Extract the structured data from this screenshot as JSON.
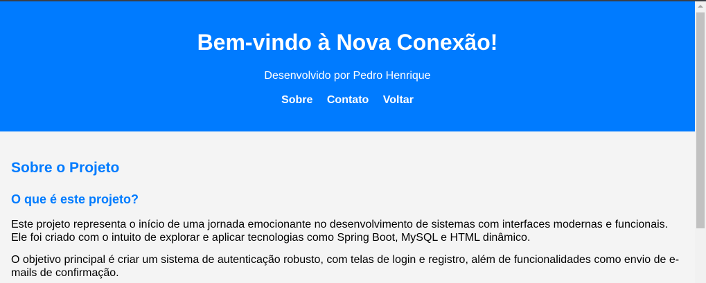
{
  "header": {
    "title": "Bem-vindo à Nova Conexão!",
    "subtitle": "Desenvolvido por Pedro Henrique",
    "nav": [
      {
        "label": "Sobre"
      },
      {
        "label": "Contato"
      },
      {
        "label": "Voltar"
      }
    ]
  },
  "main": {
    "section_title": "Sobre o Projeto",
    "subsection_title": "O que é este projeto?",
    "paragraph_1": "Este projeto representa o início de uma jornada emocionante no desenvolvimento de sistemas com interfaces modernas e funcionais. Ele foi criado com o intuito de explorar e aplicar tecnologias como Spring Boot, MySQL e HTML dinâmico.",
    "paragraph_2": "O objetivo principal é criar um sistema de autenticação robusto, com telas de login e registro, além de funcionalidades como envio de e-mails de confirmação."
  },
  "colors": {
    "brand_blue": "#007bff",
    "background": "#f4f4f4",
    "text": "#000000"
  },
  "icons": {
    "scroll_up": "chevron-up-icon"
  }
}
